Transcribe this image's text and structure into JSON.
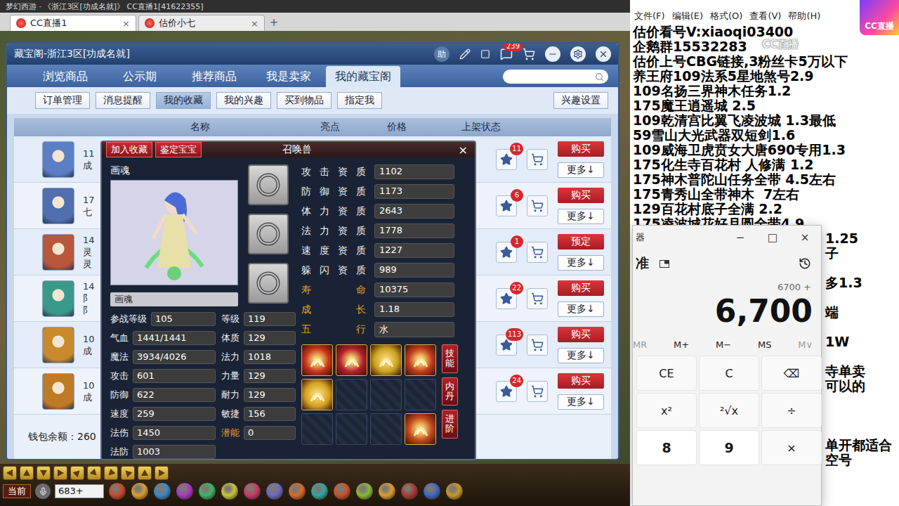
{
  "top_bar": {
    "title": "梦幻西游 · 《浙江3区[功成名就]》 CC直播1[41622355]"
  },
  "browser_tabs": [
    {
      "label": "CC直播1",
      "close": "×",
      "selected": true
    },
    {
      "label": "估价小七",
      "close": "×",
      "selected": false
    }
  ],
  "new_tab_button": "+",
  "cbg": {
    "title": "藏宝阁-浙江3区[功成名就]",
    "help": "助",
    "message_badge": "239",
    "nav_tabs": [
      {
        "label": "浏览商品",
        "selected": false
      },
      {
        "label": "公示期",
        "selected": false
      },
      {
        "label": "推荐商品",
        "selected": false
      },
      {
        "label": "我是卖家",
        "selected": false
      },
      {
        "label": "我的藏宝阁",
        "selected": true
      }
    ],
    "sub_tabs": [
      {
        "label": "订单管理",
        "selected": false
      },
      {
        "label": "消息提醒",
        "selected": false
      },
      {
        "label": "我的收藏",
        "selected": true
      },
      {
        "label": "我的兴趣",
        "selected": false
      },
      {
        "label": "买到物品",
        "selected": false
      },
      {
        "label": "指定我",
        "selected": false
      }
    ],
    "interest_button": "兴趣设置",
    "columns": [
      "名称",
      "亮点",
      "价格",
      "上架状态"
    ],
    "rows": [
      {
        "lines": [
          "11",
          "成"
        ],
        "color": "#5b7fc4",
        "favorites": "11",
        "action": "购买",
        "more": "更多↓"
      },
      {
        "lines": [
          "17",
          "七"
        ],
        "color": "#4f6fae",
        "favorites": "6",
        "action": "购买",
        "more": "更多↓"
      },
      {
        "lines": [
          "14",
          "灵",
          "灵"
        ],
        "color": "#b8573a",
        "favorites": "1",
        "action": "预定",
        "more": "更多↓"
      },
      {
        "lines": [
          "14",
          "阝",
          "阝"
        ],
        "color": "#3a9a8a",
        "favorites": "22",
        "action": "购买",
        "more": "更多↓"
      },
      {
        "lines": [
          "10",
          "成"
        ],
        "color": "#c88a2a",
        "favorites": "113",
        "action": "购买",
        "more": "更多↓"
      },
      {
        "lines": [
          "10",
          "成"
        ],
        "color": "#c07a26",
        "favorites": "24",
        "action": "购买",
        "more": "更多↓"
      }
    ],
    "wallet": "钱包余额：260"
  },
  "pet": {
    "header_buttons": [
      "加入收藏",
      "鉴定宝宝"
    ],
    "title": "召唤兽",
    "close": "×",
    "name": "画魂",
    "name_field": "画魂",
    "equipment": [
      {
        "filled": true
      },
      {
        "filled": true
      },
      {
        "filled": true
      }
    ],
    "stats": [
      {
        "label": "参战等级",
        "value": "105",
        "highlight": false
      },
      {
        "label": "等级",
        "value": "119",
        "highlight": false
      },
      {
        "label": "气血",
        "value": "1441/1441",
        "highlight": false
      },
      {
        "label": "体质",
        "value": "129",
        "highlight": false
      },
      {
        "label": "魔法",
        "value": "3934/4026",
        "highlight": false
      },
      {
        "label": "法力",
        "value": "1018",
        "highlight": false
      },
      {
        "label": "攻击",
        "value": "601",
        "highlight": false
      },
      {
        "label": "力量",
        "value": "129",
        "highlight": false
      },
      {
        "label": "防御",
        "value": "622",
        "highlight": false
      },
      {
        "label": "耐力",
        "value": "129",
        "highlight": false
      },
      {
        "label": "速度",
        "value": "259",
        "highlight": false
      },
      {
        "label": "敏捷",
        "value": "156",
        "highlight": false
      },
      {
        "label": "法伤",
        "value": "1450",
        "highlight": false
      },
      {
        "label": "潜能",
        "value": "0",
        "highlight": true
      },
      {
        "label": "法防",
        "value": "1003",
        "highlight": false
      }
    ],
    "aptitudes": [
      {
        "label": "攻击资质",
        "value": "1102",
        "highlight": false
      },
      {
        "label": "防御资质",
        "value": "1173",
        "highlight": false
      },
      {
        "label": "体力资质",
        "value": "2643",
        "highlight": false
      },
      {
        "label": "法力资质",
        "value": "1778",
        "highlight": false
      },
      {
        "label": "速度资质",
        "value": "1227",
        "highlight": false
      },
      {
        "label": "躲闪资质",
        "value": "989",
        "highlight": false
      },
      {
        "label": "寿命",
        "value": "10375",
        "highlight": true
      },
      {
        "label": "成长",
        "value": "1.18",
        "highlight": true
      },
      {
        "label": "五行",
        "value": "水",
        "highlight": true
      }
    ],
    "skills": [
      {
        "filled": true,
        "color": "#c8341c"
      },
      {
        "filled": true,
        "color": "#b3202a"
      },
      {
        "filled": true,
        "color": "#c9a21e"
      },
      {
        "filled": true,
        "color": "#c23a1c"
      },
      {
        "filled": true,
        "color": "#d4a420"
      },
      {
        "filled": false,
        "color": "#1c2536"
      },
      {
        "filled": false,
        "color": "#1c2536"
      },
      {
        "filled": false,
        "color": "#1c2536"
      },
      {
        "filled": false,
        "color": "#1c2536"
      },
      {
        "filled": false,
        "color": "#1c2536"
      },
      {
        "filled": false,
        "color": "#1c2536"
      },
      {
        "filled": true,
        "color": "#c2461a"
      }
    ],
    "side_buttons": [
      "技能",
      "内丹",
      "进阶"
    ]
  },
  "game_bar": {
    "channel": "当前",
    "chat_input": "683+"
  },
  "notepad": {
    "menu": [
      "文件(F)",
      "编辑(E)",
      "格式(O)",
      "查看(V)",
      "帮助(H)"
    ],
    "lines": [
      {
        "text": "估价看号V:xiaoqi03400",
        "kind": "full"
      },
      {
        "text": "企鹅群15532283",
        "kind": "full"
      },
      {
        "text": "估价上号CBG链接,3粉丝卡5万以下",
        "kind": "full"
      },
      {
        "text": "养王府109法系5星地煞号2.9",
        "kind": "full"
      },
      {
        "text": "109名扬三界神木任务1.2",
        "kind": "full"
      },
      {
        "text": "175魔王逍遥城 2.5",
        "kind": "full"
      },
      {
        "text": "109乾清宫比翼飞凌波城 1.3最低",
        "kind": "full"
      },
      {
        "text": "59雪山大光武器双短剑1.6",
        "kind": "full"
      },
      {
        "text": "109威海卫虎贲女大唐690专用1.3",
        "kind": "full"
      },
      {
        "text": "175化生寺百花村 人修满 1.2",
        "kind": "full"
      },
      {
        "text": "175神木普陀山任务全带 4.5左右",
        "kind": "full"
      },
      {
        "text": "175青秀山全带神木  7左右",
        "kind": "full"
      },
      {
        "text": "129百花村底子全满 2.2",
        "kind": "full"
      },
      {
        "text": "175凌波城花好月圆全带4.9",
        "kind": "full"
      },
      {
        "text": "1.25",
        "kind": "partial"
      },
      {
        "text": "子",
        "kind": "partial"
      },
      {
        "text": "",
        "kind": "partial"
      },
      {
        "text": "多1.3",
        "kind": "partial"
      },
      {
        "text": "",
        "kind": "partial"
      },
      {
        "text": "端",
        "kind": "partial"
      },
      {
        "text": "",
        "kind": "partial"
      },
      {
        "text": "1W",
        "kind": "partial"
      },
      {
        "text": "",
        "kind": "partial"
      },
      {
        "text": "寺单卖",
        "kind": "partial"
      },
      {
        "text": "可以的",
        "kind": "partial"
      },
      {
        "text": "",
        "kind": "partial"
      },
      {
        "text": "",
        "kind": "partial"
      },
      {
        "text": "",
        "kind": "partial"
      },
      {
        "text": "单开都适合",
        "kind": "partial"
      },
      {
        "text": "空号",
        "kind": "partial"
      }
    ]
  },
  "calculator": {
    "title": "器",
    "mode": "准",
    "controls": [
      "−",
      "□",
      "×"
    ],
    "expression": "6700 +",
    "display": "6,700",
    "memory": [
      {
        "label": "MR",
        "disabled": true
      },
      {
        "label": "M+",
        "disabled": false
      },
      {
        "label": "M−",
        "disabled": false
      },
      {
        "label": "MS",
        "disabled": false
      },
      {
        "label": "M∨",
        "disabled": true
      }
    ],
    "keys": [
      {
        "label": "CE",
        "kind": "function"
      },
      {
        "label": "C",
        "kind": "function"
      },
      {
        "label": "⌫",
        "kind": "function"
      },
      {
        "label": "x²",
        "kind": "function"
      },
      {
        "label": "²√x",
        "kind": "function"
      },
      {
        "label": "÷",
        "kind": "function"
      },
      {
        "label": "8",
        "kind": "number"
      },
      {
        "label": "9",
        "kind": "number"
      },
      {
        "label": "×",
        "kind": "function"
      }
    ]
  },
  "overlays": {
    "logo": "CC直播",
    "watermark": "CC直播"
  }
}
